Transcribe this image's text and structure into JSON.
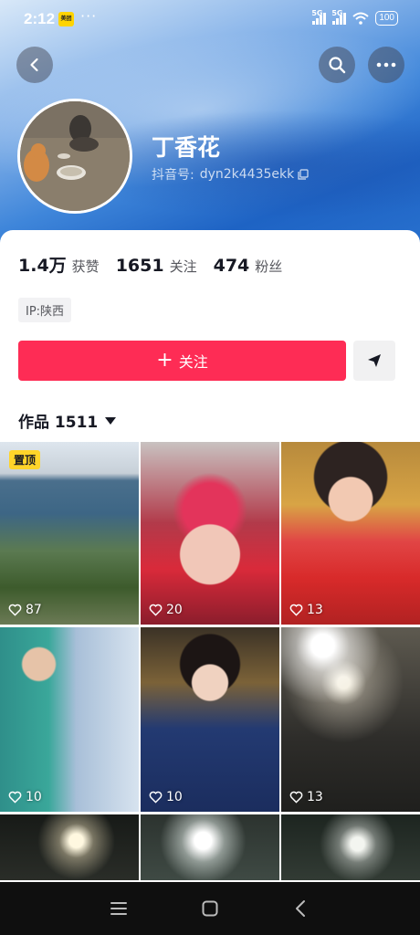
{
  "status_bar": {
    "time": "2:12",
    "app_badge": "美团",
    "more": "···",
    "network_1": "5G",
    "network_2": "5G",
    "battery": "100"
  },
  "profile": {
    "name": "丁香花",
    "id_label": "抖音号:",
    "id_value": "dyn2k4435ekk",
    "ip_tag": "IP:陕西"
  },
  "stats": {
    "likes_num": "1.4万",
    "likes_label": "获赞",
    "following_num": "1651",
    "following_label": "关注",
    "followers_num": "474",
    "followers_label": "粉丝"
  },
  "actions": {
    "follow_plus": "+",
    "follow_label": "关注"
  },
  "works": {
    "title": "作品 1511"
  },
  "videos": [
    {
      "likes": "87",
      "pinned_label": "置顶"
    },
    {
      "likes": "20"
    },
    {
      "likes": "13"
    },
    {
      "likes": "10"
    },
    {
      "likes": "10"
    },
    {
      "likes": "13"
    }
  ],
  "icons": {
    "back": "chevron-left-icon",
    "search": "search-icon",
    "more": "more-dots-icon",
    "copy": "copy-icon",
    "send": "send-arrow-icon",
    "heart": "heart-outline-icon",
    "nav_menu": "menu-icon",
    "nav_home": "home-square-icon",
    "nav_back": "back-triangle-icon"
  },
  "colors": {
    "accent": "#fe2c55",
    "pin_badge": "#ffd42a"
  }
}
